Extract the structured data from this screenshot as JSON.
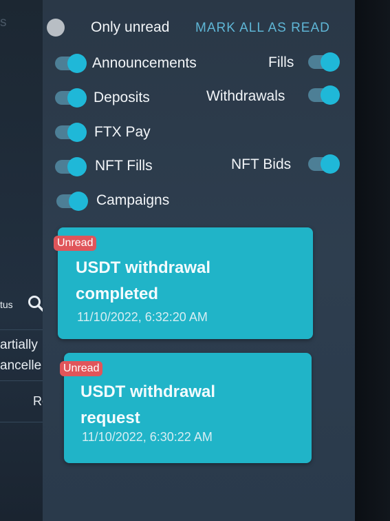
{
  "left": {
    "partial_top": "s",
    "status_label": "tus",
    "row1": "artially",
    "row2": "ancelle",
    "row3": "Ro"
  },
  "filters": {
    "only_unread": "Only unread",
    "mark_all": "MARK ALL AS READ",
    "announcements": "Announcements",
    "fills": "Fills",
    "deposits": "Deposits",
    "withdrawals": "Withdrawals",
    "ftx_pay": "FTX Pay",
    "nft_fills": "NFT Fills",
    "nft_bids": "NFT Bids",
    "campaigns": "Campaigns",
    "states": {
      "only_unread": false,
      "announcements": true,
      "fills": true,
      "deposits": true,
      "withdrawals": true,
      "ftx_pay": true,
      "nft_fills": true,
      "nft_bids": true,
      "campaigns": true
    }
  },
  "notifications": [
    {
      "badge": "Unread",
      "title_line1": "USDT withdrawal",
      "title_line2": "completed",
      "time": "11/10/2022, 6:32:20 AM"
    },
    {
      "badge": "Unread",
      "title_line1": "USDT withdrawal",
      "title_line2": "request",
      "time": "11/10/2022, 6:30:22 AM"
    }
  ],
  "colors": {
    "card": "#20b4c8",
    "badge": "#e0555a",
    "toggle_knob": "#1fb8d8",
    "accent_link": "#5fb6d6"
  }
}
